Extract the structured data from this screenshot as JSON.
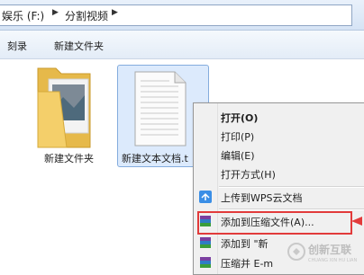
{
  "address": {
    "drive": "娱乐 (F:)",
    "folder": "分割视频"
  },
  "toolbar": {
    "burn_label": "刻录",
    "new_folder_label": "新建文件夹"
  },
  "files": [
    {
      "name": "新建文件夹",
      "type": "folder"
    },
    {
      "name": "新建文本文档.t",
      "type": "text-document",
      "selected": true
    }
  ],
  "context_menu": {
    "open": "打开(O)",
    "print": "打印(P)",
    "edit": "编辑(E)",
    "open_with": "打开方式(H)",
    "upload_wps": "上传到WPS云文档",
    "add_archive": "添加到压缩文件(A)...",
    "add_to_named": "添加到 \"新",
    "compress_email": "压缩并 E-m"
  },
  "watermark": {
    "brand": "创新互联",
    "sub": "CHUANG XIN HU LIAN"
  },
  "colors": {
    "highlight": "#e23b3b",
    "selection": "#dceafc"
  }
}
